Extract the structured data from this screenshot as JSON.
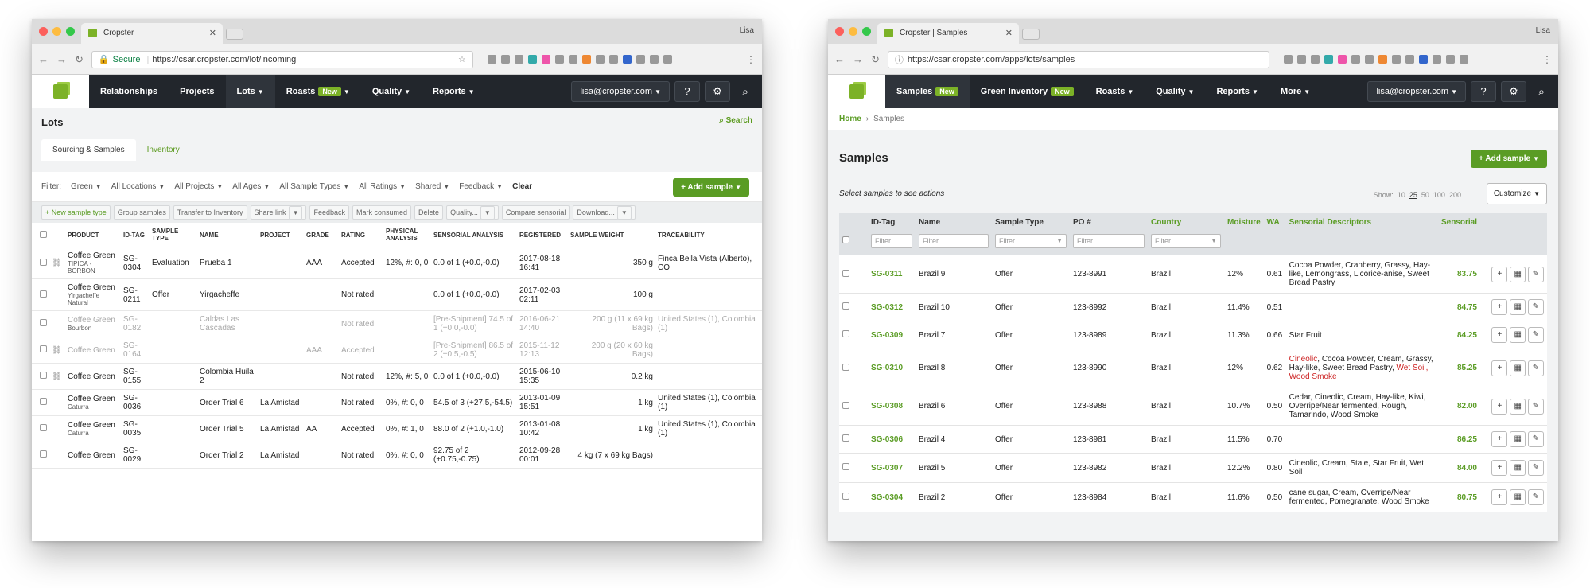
{
  "w1": {
    "tab_title": "Cropster",
    "profile": "Lisa",
    "url_secure": "Secure",
    "url": "https://csar.cropster.com/lot/incoming",
    "nav": [
      "Relationships",
      "Projects",
      "Lots",
      "Roasts",
      "Quality",
      "Reports"
    ],
    "nav_badge": "New",
    "user": "lisa@cropster.com",
    "page_title": "Lots",
    "search_link": "Search",
    "subtabs": [
      "Sourcing & Samples",
      "Inventory"
    ],
    "filter_label": "Filter:",
    "filters": [
      "Green",
      "All Locations",
      "All Projects",
      "All Ages",
      "All Sample Types",
      "All Ratings",
      "Shared",
      "Feedback"
    ],
    "clear": "Clear",
    "add_sample": "+ Add sample",
    "actions": [
      "+ New sample type",
      "Group samples",
      "Transfer to Inventory",
      "Share link",
      "Feedback",
      "Mark consumed",
      "Delete",
      "Quality...",
      "Compare sensorial",
      "Download..."
    ],
    "headers": [
      "PRODUCT",
      "ID-TAG",
      "SAMPLE TYPE",
      "NAME",
      "PROJECT",
      "GRADE",
      "RATING",
      "PHYSICAL ANALYSIS",
      "SENSORIAL ANALYSIS",
      "REGISTERED",
      "SAMPLE WEIGHT",
      "TRACEABILITY"
    ],
    "rows": [
      {
        "product": "Coffee Green",
        "sub": "TIPICA - BORBON",
        "id": "SG-0304",
        "type": "Evaluation",
        "name": "Prueba 1",
        "project": "",
        "grade": "AAA",
        "rating": "Accepted",
        "phys": "12%, #: 0, 0",
        "sens": "0.0 of 1 (+0.0,-0.0)",
        "reg": "2017-08-18 16:41",
        "weight": "350 g",
        "trace": "Finca Bella Vista (Alberto), CO"
      },
      {
        "product": "Coffee Green",
        "sub": "Yirgacheffe Natural",
        "id": "SG-0211",
        "type": "Offer",
        "name": "Yirgacheffe",
        "project": "",
        "grade": "",
        "rating": "Not rated",
        "phys": "",
        "sens": "0.0 of 1 (+0.0,-0.0)",
        "reg": "2017-02-03 02:11",
        "weight": "100 g",
        "trace": ""
      },
      {
        "product": "Coffee Green",
        "sub": "Bourbon",
        "id": "SG-0182",
        "type": "",
        "name": "Caldas Las Cascadas",
        "project": "",
        "grade": "",
        "rating": "Not rated",
        "phys": "",
        "sens": "[Pre-Shipment] 74.5 of 1 (+0.0,-0.0)",
        "reg": "2016-06-21 14:40",
        "weight": "200 g  (11 x 69 kg Bags)",
        "trace": "United States (1), Colombia (1)"
      },
      {
        "product": "Coffee Green",
        "sub": "",
        "id": "SG-0164",
        "type": "",
        "name": "",
        "project": "",
        "grade": "AAA",
        "rating": "Accepted",
        "phys": "",
        "sens": "[Pre-Shipment] 86.5 of 2 (+0.5,-0.5)",
        "reg": "2015-11-12 12:13",
        "weight": "200 g  (20 x 60 kg Bags)",
        "trace": ""
      },
      {
        "product": "Coffee Green",
        "sub": "",
        "id": "SG-0155",
        "type": "",
        "name": "Colombia Huila 2",
        "project": "",
        "grade": "",
        "rating": "Not rated",
        "phys": "12%, #: 5, 0",
        "sens": "0.0 of 1 (+0.0,-0.0)",
        "reg": "2015-06-10 15:35",
        "weight": "0.2 kg",
        "trace": ""
      },
      {
        "product": "Coffee Green",
        "sub": "Caturra",
        "id": "SG-0036",
        "type": "",
        "name": "Order Trial 6",
        "project": "La Amistad",
        "grade": "",
        "rating": "Not rated",
        "phys": "0%, #: 0, 0",
        "sens": "54.5 of 3 (+27.5,-54.5)",
        "reg": "2013-01-09 15:51",
        "weight": "1 kg",
        "trace": "United States (1), Colombia (1)"
      },
      {
        "product": "Coffee Green",
        "sub": "Caturra",
        "id": "SG-0035",
        "type": "",
        "name": "Order Trial 5",
        "project": "La Amistad",
        "grade": "AA",
        "rating": "Accepted",
        "phys": "0%, #: 1, 0",
        "sens": "88.0 of 2 (+1.0,-1.0)",
        "reg": "2013-01-08 10:42",
        "weight": "1 kg",
        "trace": "United States (1), Colombia (1)"
      },
      {
        "product": "Coffee Green",
        "sub": "",
        "id": "SG-0029",
        "type": "",
        "name": "Order Trial 2",
        "project": "La Amistad",
        "grade": "",
        "rating": "Not rated",
        "phys": "0%, #: 0, 0",
        "sens": "92.75 of 2 (+0.75,-0.75)",
        "reg": "2012-09-28 00:01",
        "weight": "4 kg  (7 x 69 kg Bags)",
        "trace": ""
      }
    ]
  },
  "w2": {
    "tab_title": "Cropster | Samples",
    "profile": "Lisa",
    "url": "https://csar.cropster.com/apps/lots/samples",
    "nav": [
      "Samples",
      "Green Inventory",
      "Roasts",
      "Quality",
      "Reports",
      "More"
    ],
    "nav_badge": "New",
    "user": "lisa@cropster.com",
    "breadcrumb_home": "Home",
    "breadcrumb_current": "Samples",
    "page_title": "Samples",
    "add_sample": "+ Add sample",
    "select_hint": "Select samples to see actions",
    "show_label": "Show:",
    "show_opts": [
      "10",
      "25",
      "50",
      "100",
      "200"
    ],
    "customize": "Customize",
    "headers": [
      "ID-Tag",
      "Name",
      "Sample Type",
      "PO #",
      "Country",
      "Moisture",
      "WA",
      "Sensorial Descriptors",
      "Sensorial"
    ],
    "filter_ph": "Filter...",
    "rows": [
      {
        "id": "SG-0311",
        "name": "Brazil 9",
        "type": "Offer",
        "po": "123-8991",
        "country": "Brazil",
        "moist": "12%",
        "wa": "0.61",
        "desc": "Cocoa Powder, Cranberry, Grassy, Hay-like, Lemongrass, Licorice-anise, Sweet Bread Pastry",
        "desc_red": "",
        "score": "83.75"
      },
      {
        "id": "SG-0312",
        "name": "Brazil 10",
        "type": "Offer",
        "po": "123-8992",
        "country": "Brazil",
        "moist": "11.4%",
        "wa": "0.51",
        "desc": "",
        "desc_red": "",
        "score": "84.75"
      },
      {
        "id": "SG-0309",
        "name": "Brazil 7",
        "type": "Offer",
        "po": "123-8989",
        "country": "Brazil",
        "moist": "11.3%",
        "wa": "0.66",
        "desc": "Star Fruit",
        "desc_red": "",
        "score": "84.25"
      },
      {
        "id": "SG-0310",
        "name": "Brazil 8",
        "type": "Offer",
        "po": "123-8990",
        "country": "Brazil",
        "moist": "12%",
        "wa": "0.62",
        "desc": "Cocoa Powder, Cream, Grassy, Hay-like, Sweet Bread Pastry,",
        "desc_red": "Cineolic",
        "desc_tail": "Wet Soil, Wood Smoke",
        "score": "85.25"
      },
      {
        "id": "SG-0308",
        "name": "Brazil 6",
        "type": "Offer",
        "po": "123-8988",
        "country": "Brazil",
        "moist": "10.7%",
        "wa": "0.50",
        "desc": "Cedar, Cineolic, Cream, Hay-like, Kiwi, Overripe/Near fermented, Rough, Tamarindo, Wood Smoke",
        "desc_red": "",
        "score": "82.00"
      },
      {
        "id": "SG-0306",
        "name": "Brazil 4",
        "type": "Offer",
        "po": "123-8981",
        "country": "Brazil",
        "moist": "11.5%",
        "wa": "0.70",
        "desc": "",
        "desc_red": "",
        "score": "86.25"
      },
      {
        "id": "SG-0307",
        "name": "Brazil 5",
        "type": "Offer",
        "po": "123-8982",
        "country": "Brazil",
        "moist": "12.2%",
        "wa": "0.80",
        "desc": "Cineolic, Cream, Stale, Star Fruit, Wet Soil",
        "desc_red": "",
        "score": "84.00"
      },
      {
        "id": "SG-0304",
        "name": "Brazil 2",
        "type": "Offer",
        "po": "123-8984",
        "country": "Brazil",
        "moist": "11.6%",
        "wa": "0.50",
        "desc": "cane sugar, Cream, Overripe/Near fermented, Pomegranate, Wood Smoke",
        "desc_red": "",
        "score": "80.75"
      }
    ]
  }
}
